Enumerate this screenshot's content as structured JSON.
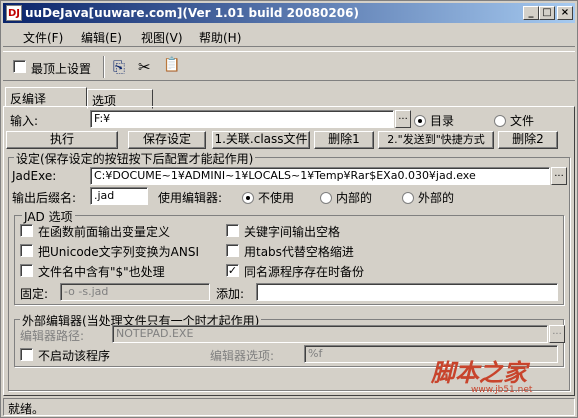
{
  "window": {
    "icon_text": "DJ",
    "title": "uuDeJava[uuware.com](Ver 1.01 build 20080206)",
    "min_glyph": "_",
    "max_glyph": "□",
    "close_glyph": "×"
  },
  "menu": [
    "文件(F)",
    "编辑(E)",
    "视图(V)",
    "帮助(H)"
  ],
  "toolbar": {
    "topmost_label": "最顶上设置",
    "copy_glyph": "⎘",
    "cut_glyph": "✂",
    "paste_glyph": "📋"
  },
  "tabs": [
    "反编译",
    "选项"
  ],
  "input_row": {
    "label": "输入:",
    "value": "F:¥",
    "browse": "...",
    "radio_dir": "目录",
    "radio_file": "文件"
  },
  "actions": [
    "执行",
    "保存设定",
    "1.关联.class文件",
    "删除1",
    "2.\"发送到\"快捷方式",
    "删除2"
  ],
  "settings": {
    "legend": "设定(保存设定的按钮按下后配置才能起作用)",
    "jadexe_label": "JadExe:",
    "jadexe_value": "C:¥DOCUME~1¥ADMINI~1¥LOCALS~1¥Temp¥Rar$EXa0.030¥jad.exe",
    "browse": "...",
    "suffix_label": "输出后缀名:",
    "suffix_value": ".jad",
    "editor_label": "使用编辑器:",
    "editor_options": [
      "不使用",
      "内部的",
      "外部的"
    ]
  },
  "jad": {
    "legend": "JAD 选项",
    "options": [
      {
        "label": "在函数前面输出变量定义",
        "checked": false
      },
      {
        "label": "关键字间输出空格",
        "checked": false
      },
      {
        "label": "把Unicode文字列变换为ANSI",
        "checked": false
      },
      {
        "label": "用tabs代替空格缩进",
        "checked": false
      },
      {
        "label": "文件名中含有\"$\"也处理",
        "checked": false
      },
      {
        "label": "同名源程序存在时备份",
        "checked": true
      }
    ],
    "fixed_label": "固定:",
    "fixed_value": "-o -s.jad",
    "add_label": "添加:",
    "add_value": ""
  },
  "external": {
    "legend": "外部编辑器(当处理文件只有一个时才起作用)",
    "path_label": "编辑器路径:",
    "path_value": "NOTEPAD.EXE",
    "browse": "...",
    "noautostart_label": "不启动该程序",
    "options_label": "编辑器选项:",
    "options_value": "%f"
  },
  "status": "就绪。",
  "watermark": {
    "text": "脚本之家",
    "sub": "www.jb51.net"
  },
  "colors": {
    "title_start": "#0a246a",
    "title_end": "#a6caf0",
    "face": "#d4d0c8",
    "active_tab": "#c00000",
    "watermark": "#c8442c"
  }
}
